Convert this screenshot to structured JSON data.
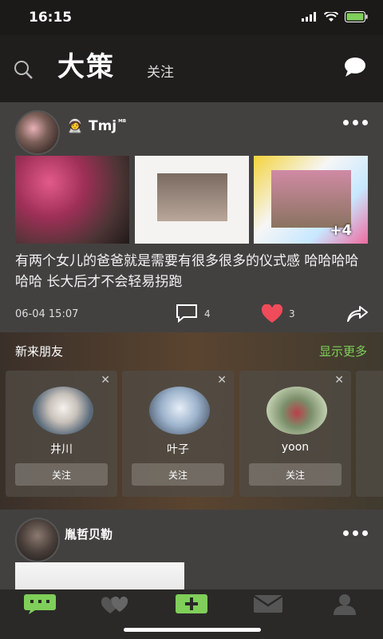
{
  "status": {
    "time": "16:15"
  },
  "header": {
    "title": "大策",
    "follow_tab": "关注"
  },
  "post": {
    "username": "Tmj",
    "username_suffix": "ᴹᴮ",
    "badge_emoji": "🧑‍🚀",
    "images_more_count": "+4",
    "text": "有两个女儿的爸爸就是需要有很多很多的仪式感 哈哈哈哈哈哈  长大后才不会轻易拐跑",
    "time": "06-04 15:07",
    "comment_count": "4",
    "like_count": "3"
  },
  "friends": {
    "title": "新来朋友",
    "show_more": "显示更多",
    "follow_label": "关注",
    "items": [
      {
        "name": "井川"
      },
      {
        "name": "叶子"
      },
      {
        "name": "yoon"
      }
    ]
  },
  "post2": {
    "username": "胤哲贝勒"
  },
  "colors": {
    "accent": "#7fcf5a",
    "heart": "#f04b5a"
  },
  "nav": {
    "items": [
      "home-icon",
      "discover-icon",
      "add-icon",
      "mail-icon",
      "profile-icon"
    ]
  }
}
